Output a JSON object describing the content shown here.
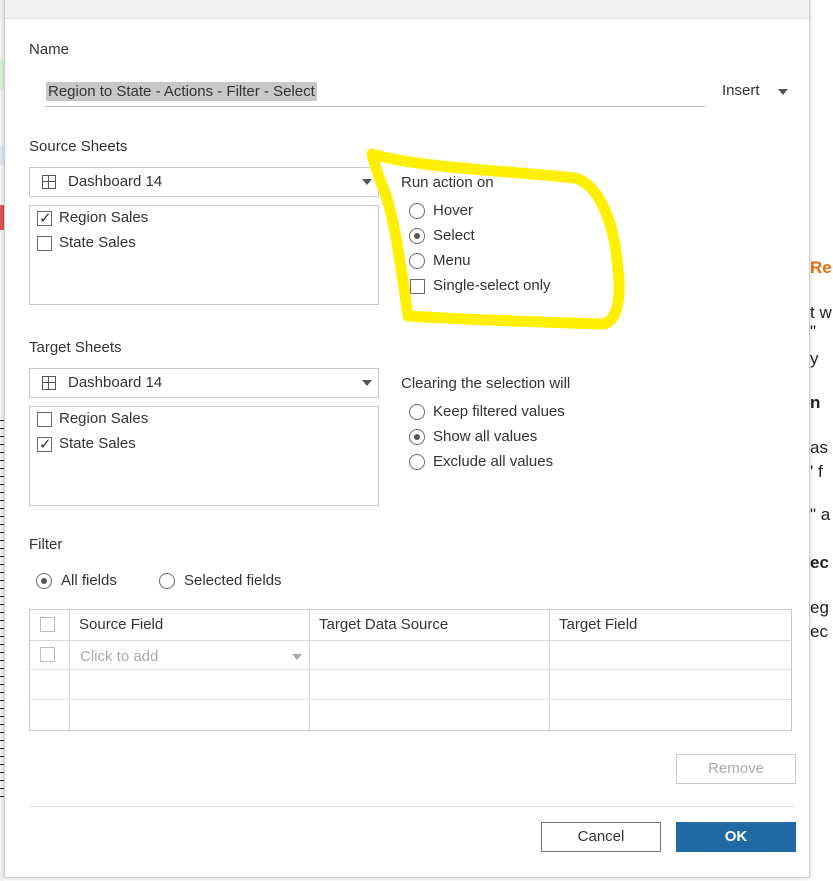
{
  "dialog": {
    "name_label": "Name",
    "name_value": "Region to State - Actions - Filter - Select",
    "insert_label": "Insert"
  },
  "source": {
    "heading": "Source Sheets",
    "dashboard": "Dashboard 14",
    "sheets": [
      {
        "label": "Region Sales",
        "checked": true
      },
      {
        "label": "State Sales",
        "checked": false
      }
    ]
  },
  "run_action": {
    "heading": "Run action on",
    "options": [
      "Hover",
      "Select",
      "Menu"
    ],
    "selected": "Select",
    "single_select_label": "Single-select only",
    "single_select_checked": false
  },
  "target": {
    "heading": "Target Sheets",
    "dashboard": "Dashboard 14",
    "sheets": [
      {
        "label": "Region Sales",
        "checked": false
      },
      {
        "label": "State Sales",
        "checked": true
      }
    ]
  },
  "clearing": {
    "heading": "Clearing the selection will",
    "options": [
      "Keep filtered values",
      "Show all values",
      "Exclude all values"
    ],
    "selected": "Show all values"
  },
  "filter": {
    "heading": "Filter",
    "all_fields_label": "All fields",
    "selected_fields_label": "Selected fields",
    "selected": "All fields",
    "columns": [
      "Source Field",
      "Target Data Source",
      "Target Field"
    ],
    "add_placeholder": "Click to add"
  },
  "buttons": {
    "remove": "Remove",
    "cancel": "Cancel",
    "ok": "OK"
  },
  "background_text": [
    "Re",
    "t w",
    "\"",
    "y",
    "n",
    "as",
    "' f",
    "\" a",
    "ec",
    "eg",
    "ec"
  ],
  "colors": {
    "ok_button": "#1f6aa5",
    "highlight": "#ffef00",
    "background_accent": "#e46c0a"
  }
}
